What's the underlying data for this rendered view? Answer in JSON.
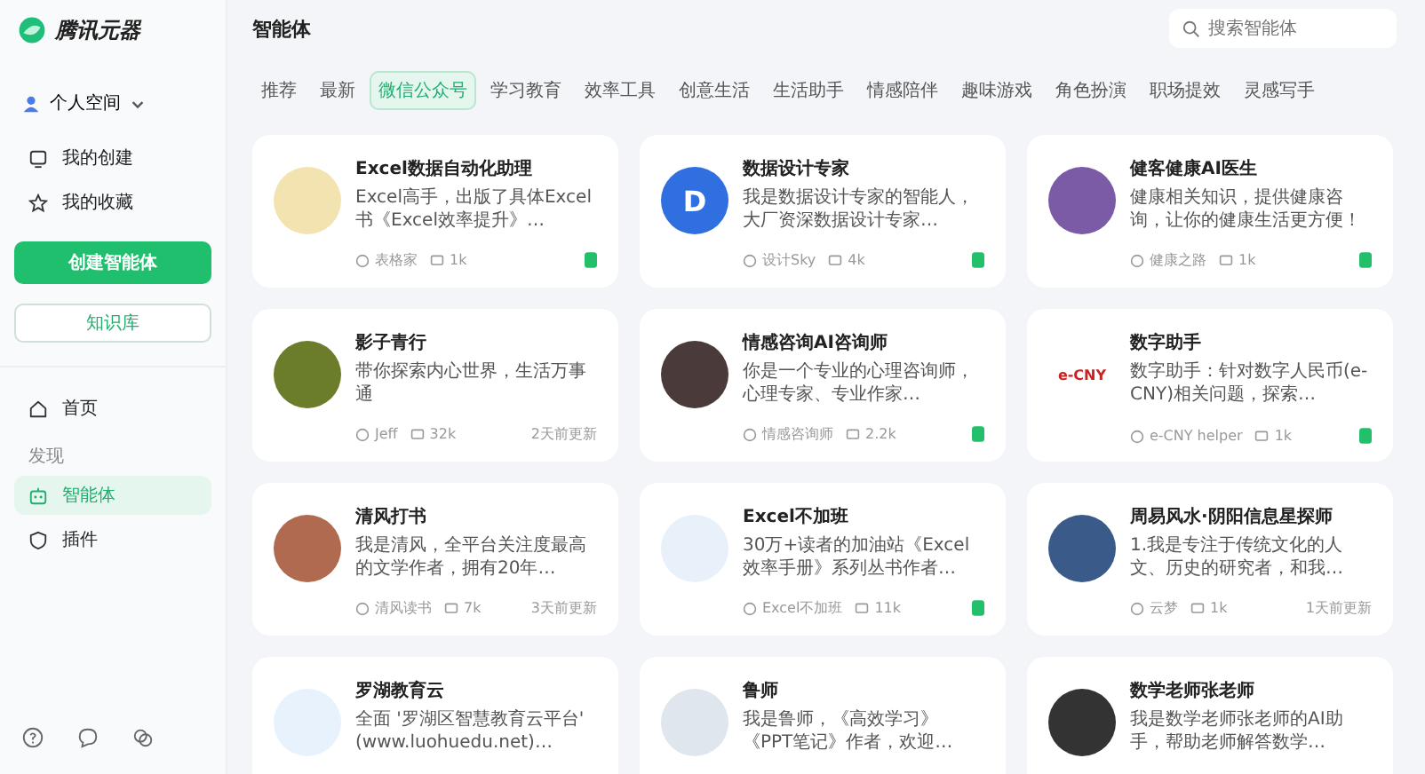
{
  "sidebar": {
    "brand": "腾讯元器",
    "space": "个人空间",
    "items": [
      {
        "label": "我的创建"
      },
      {
        "label": "我的收藏"
      }
    ],
    "create_button": "创建智能体",
    "kb_button": "知识库",
    "nav": [
      {
        "kind": "item",
        "label": "首页",
        "selected": false
      },
      {
        "kind": "section",
        "label": "发现"
      },
      {
        "kind": "item",
        "label": "智能体",
        "selected": true
      },
      {
        "kind": "item",
        "label": "插件",
        "selected": false
      }
    ]
  },
  "header": {
    "title": "智能体",
    "search": {
      "placeholder": "搜索智能体"
    }
  },
  "tabs": [
    {
      "label": "推荐",
      "selected": false
    },
    {
      "label": "最新",
      "selected": false
    },
    {
      "label": "微信公众号",
      "selected": true
    },
    {
      "label": "学习教育",
      "selected": false
    },
    {
      "label": "效率工具",
      "selected": false
    },
    {
      "label": "创意生活",
      "selected": false
    },
    {
      "label": "生活助手",
      "selected": false
    },
    {
      "label": "情感陪伴",
      "selected": false
    },
    {
      "label": "趣味游戏",
      "selected": false
    },
    {
      "label": "角色扮演",
      "selected": false
    },
    {
      "label": "职场提效",
      "selected": false
    },
    {
      "label": "灵感写手",
      "selected": false
    }
  ],
  "cards": [
    {
      "title": "Excel数据自动化助理",
      "desc": "Excel高手，出版了具体Excel书《Excel效率提升》…",
      "author": "表格家",
      "count": "1k",
      "badge": {
        "kind": "wechat"
      },
      "color": "#f3e3b0"
    },
    {
      "title": "数据设计专家",
      "desc": "我是数据设计专家的智能人，大厂资深数据设计专家…",
      "author": "设计Sky",
      "count": "4k",
      "badge": {
        "kind": "wechat"
      },
      "color": "#2f6fe0",
      "mark": "D"
    },
    {
      "title": "健客健康AI医生",
      "desc": "健康相关知识，提供健康咨询，让你的健康生活更方便！",
      "author": "健康之路",
      "count": "1k",
      "badge": {
        "kind": "wechat"
      },
      "color": "#7b5aa6"
    },
    {
      "title": "影子青行",
      "desc": "带你探索内心世界，生活万事通",
      "author": "Jeff",
      "count": "32k",
      "badge": {
        "kind": "label",
        "text": "2天前更新"
      },
      "color": "#6b7d2a"
    },
    {
      "title": "情感咨询AI咨询师",
      "desc": "你是一个专业的心理咨询师，心理专家、专业作家…",
      "author": "情感咨询师",
      "count": "2.2k",
      "badge": {
        "kind": "wechat"
      },
      "color": "#4a3a3a"
    },
    {
      "title": "数字助手",
      "desc": "数字助手：针对数字人民币(e-CNY)相关问题，探索…",
      "author": "e-CNY helper",
      "count": "1k",
      "badge": {
        "kind": "wechat"
      },
      "color": "#ffffff",
      "mark": "e-CNY"
    },
    {
      "title": "清风打书",
      "desc": "我是清风，全平台关注度最高的文学作者，拥有20年…",
      "author": "清风读书",
      "count": "7k",
      "badge": {
        "kind": "label",
        "text": "3天前更新"
      },
      "color": "#b06a50"
    },
    {
      "title": "Excel不加班",
      "desc": "30万+读者的加油站《Excel效率手册》系列丛书作者…",
      "author": "Excel不加班",
      "count": "11k",
      "badge": {
        "kind": "wechat"
      },
      "color": "#e8f0fa"
    },
    {
      "title": "周易风水·阴阳信息星探师",
      "desc": "1.我是专注于传统文化的人文、历史的研究者，和我…",
      "author": "云梦",
      "count": "1k",
      "badge": {
        "kind": "label",
        "text": "1天前更新"
      },
      "color": "#3a5a8a"
    },
    {
      "title": "罗湖教育云",
      "desc": "全面 '罗湖区智慧教育云平台' (www.luohuedu.net)…",
      "color": "#e8f2fc"
    },
    {
      "title": "鲁师",
      "desc": "我是鲁师，《高效学习》《PPT笔记》作者，欢迎…",
      "color": "#e0e6ee"
    },
    {
      "title": "数学老师张老师",
      "desc": "我是数学老师张老师的AI助手，帮助老师解答数学…",
      "color": "#333333"
    }
  ]
}
